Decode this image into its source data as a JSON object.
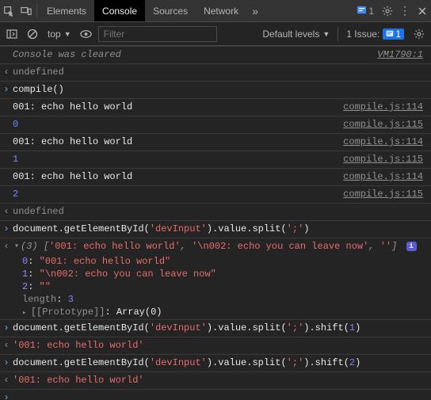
{
  "tabs": {
    "elements": "Elements",
    "console": "Console",
    "sources": "Sources",
    "network": "Network"
  },
  "errors_count": "1",
  "toolbar": {
    "context": "top",
    "filter_placeholder": "Filter",
    "levels": "Default levels",
    "issues_label": "1 Issue:",
    "issues_count": "1"
  },
  "rows": {
    "cleared": "Console was cleared",
    "cleared_src": "VM1790:1",
    "undef": "undefined",
    "compile": "compile()",
    "echo": "001: echo hello world",
    "compile114": "compile.js:114",
    "compile115": "compile.js:115",
    "n0": "0",
    "n1": "1",
    "n2": "2",
    "getById1": "document.getElementById('devInput').value.split(';')",
    "arrpreview_len": "(3)",
    "arrpreview_a": "'001: echo hello world'",
    "arrpreview_b": "'\\n002: echo you can leave now'",
    "arrpreview_c": "''",
    "exp_0k": "0",
    "exp_0v": "\"001: echo hello world\"",
    "exp_1k": "1",
    "exp_1v": "\"\\n002: echo you can leave now\"",
    "exp_2k": "2",
    "exp_2v": "\"\"",
    "exp_lenk": "length",
    "exp_lenv": "3",
    "exp_proto": "[[Prototype]]",
    "exp_protov": "Array(0)",
    "shift1_pre": "document.getElementById('devInput').value.split(';').shift(",
    "shift1_arg": "1",
    "shift1_post": ")",
    "shiftres": "'001: echo hello world'",
    "shift2_arg": "2"
  }
}
